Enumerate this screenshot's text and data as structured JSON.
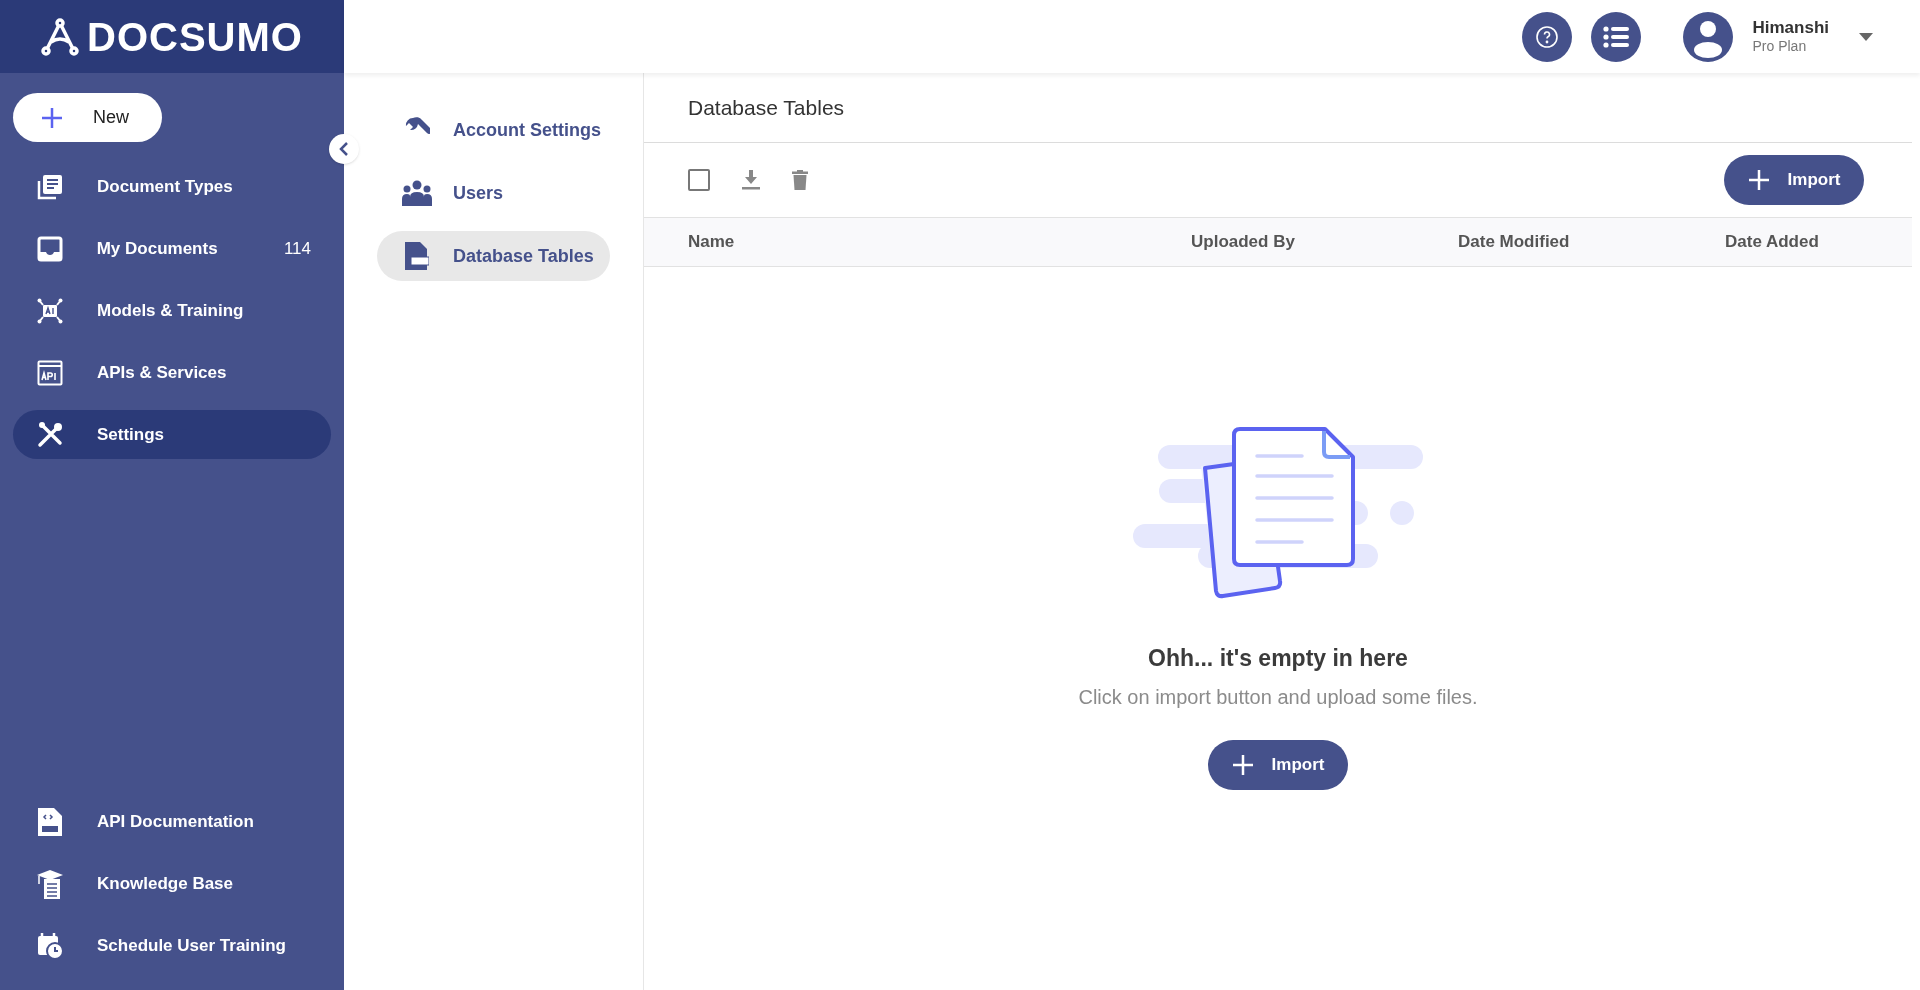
{
  "logo": {
    "text": "DOCSUMO"
  },
  "new_button": {
    "label": "New"
  },
  "sidebar": {
    "items": [
      {
        "label": "Document Types",
        "selected": false
      },
      {
        "label": "My Documents",
        "badge": "114",
        "selected": false
      },
      {
        "label": "Models & Training",
        "selected": false
      },
      {
        "label": "APIs & Services",
        "selected": false
      },
      {
        "label": "Settings",
        "selected": true
      }
    ],
    "bottom_items": [
      {
        "label": "API Documentation"
      },
      {
        "label": "Knowledge Base"
      },
      {
        "label": "Schedule User Training"
      }
    ]
  },
  "header": {
    "user_name": "Himanshi",
    "plan": "Pro Plan"
  },
  "settings_nav": {
    "items": [
      {
        "label": "Account Settings",
        "selected": false
      },
      {
        "label": "Users",
        "selected": false
      },
      {
        "label": "Database Tables",
        "selected": true
      }
    ]
  },
  "main": {
    "title": "Database Tables",
    "select_all": {
      "checked": false
    },
    "import_button": "Import",
    "table": {
      "columns": [
        "Name",
        "Uploaded By",
        "Date Modified",
        "Date Added"
      ]
    },
    "empty_state": {
      "title": "Ohh... it's empty in here",
      "subtitle": "Click on import button and upload some files.",
      "button": "Import"
    }
  }
}
